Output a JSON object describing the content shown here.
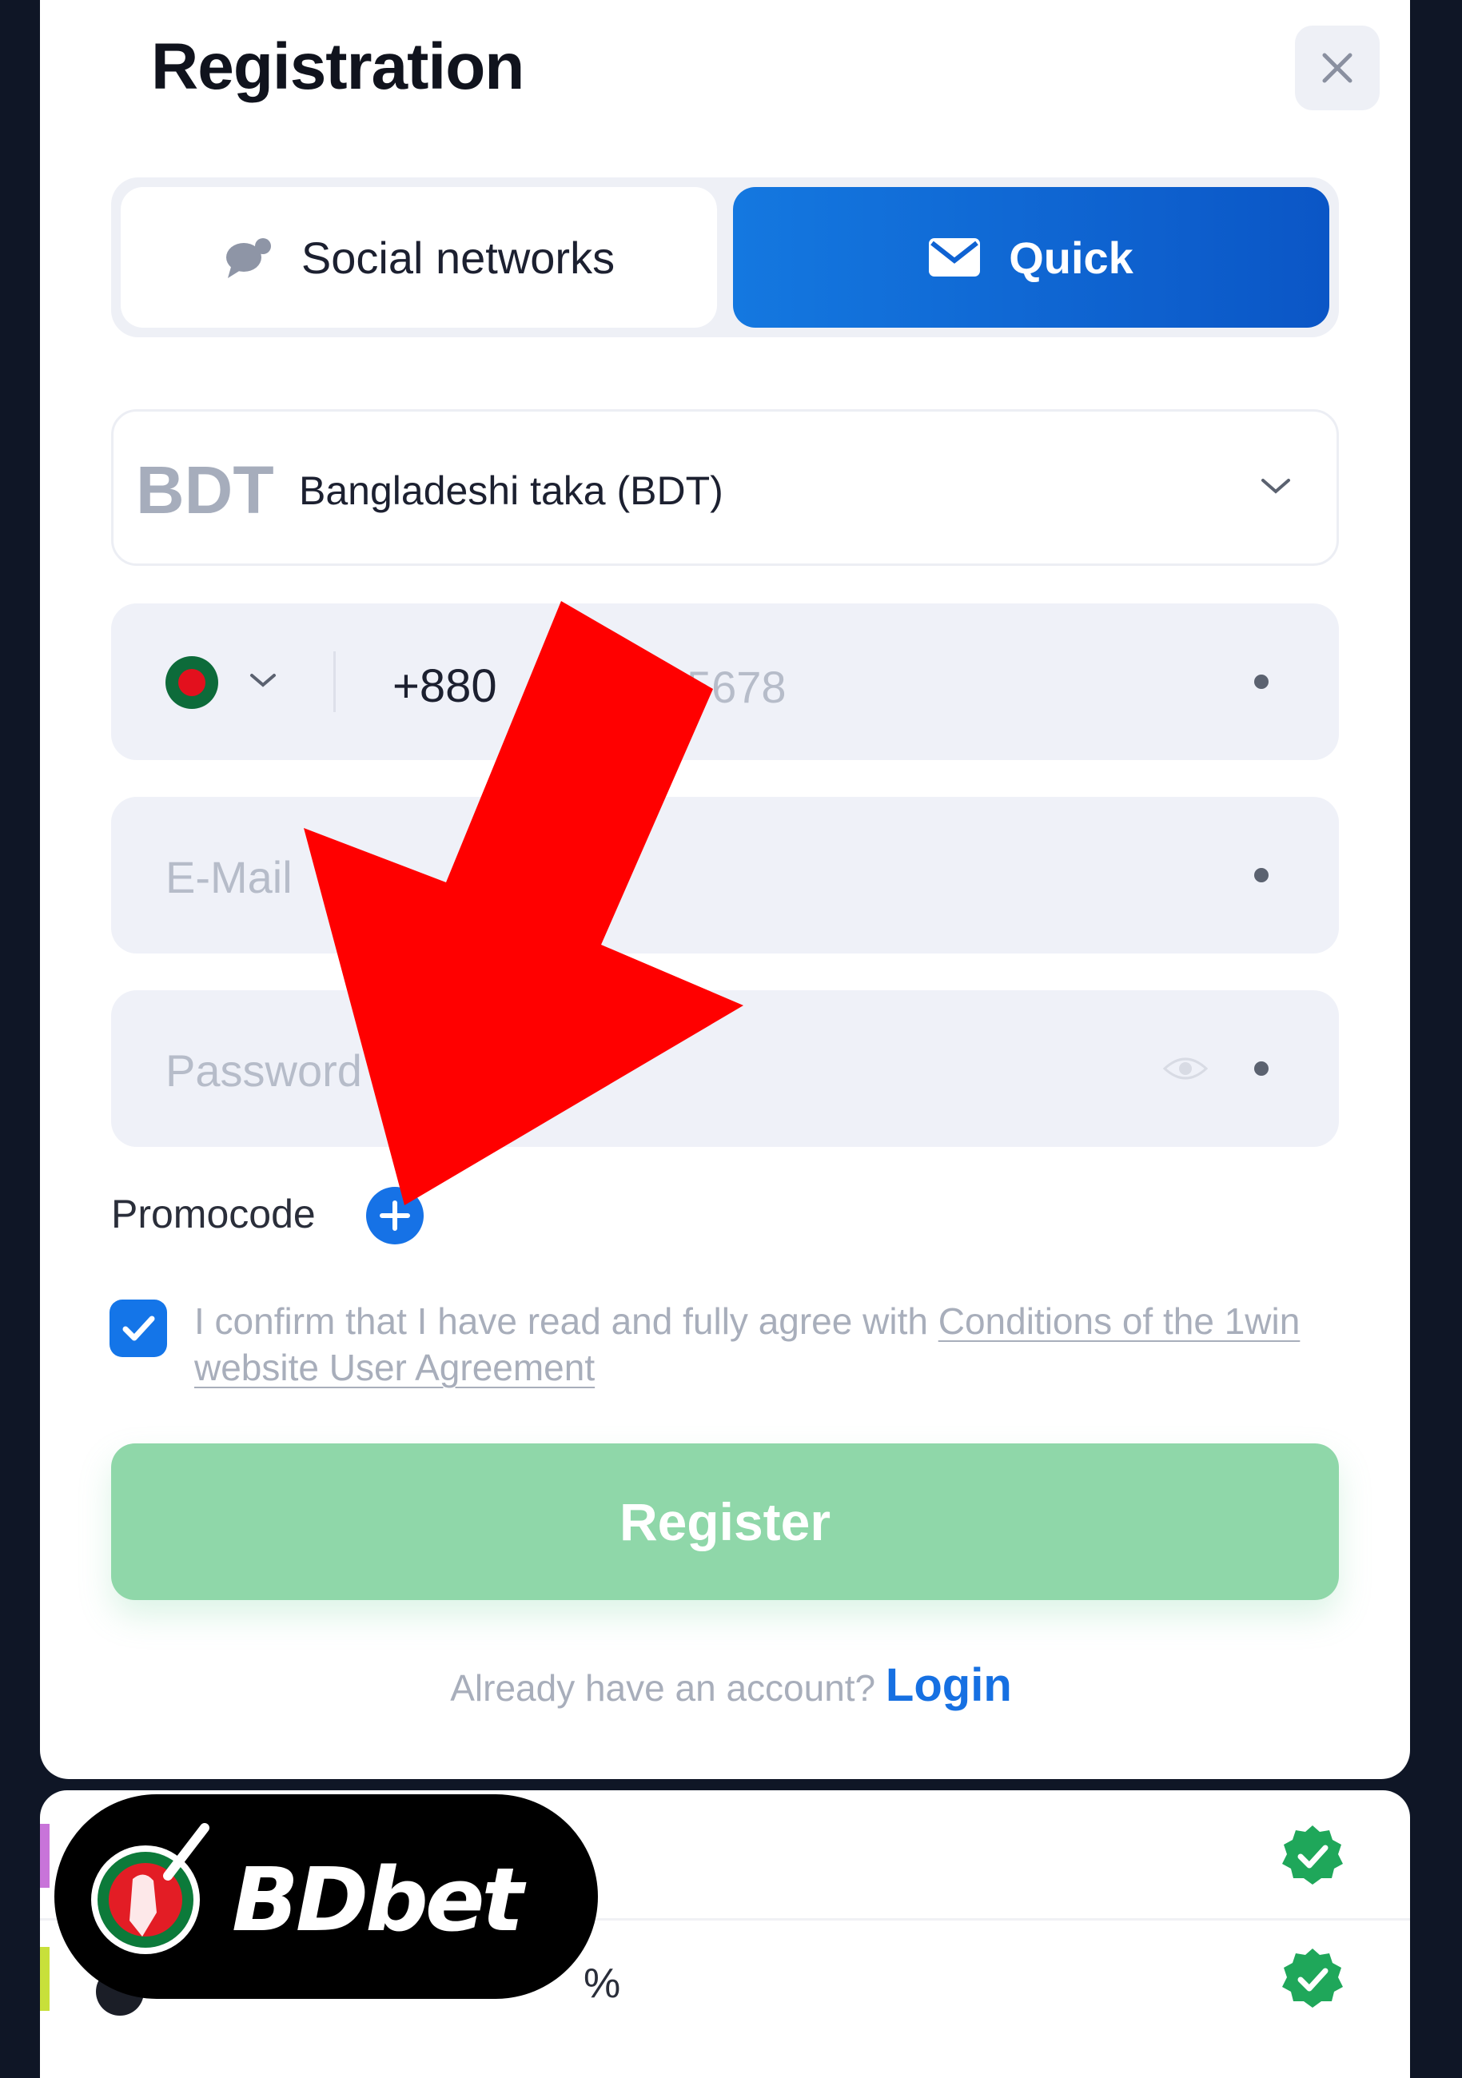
{
  "modal": {
    "title": "Registration",
    "close_icon": "close-icon"
  },
  "tabs": [
    {
      "label": "Social networks",
      "icon": "chat-bubbles-icon",
      "active": false
    },
    {
      "label": "Quick",
      "icon": "envelope-icon",
      "active": true
    }
  ],
  "currency": {
    "code": "BDT",
    "label": "Bangladeshi taka (BDT)"
  },
  "phone": {
    "country_icon": "bangladesh-flag-icon",
    "code": "+880",
    "placeholder_visible": "5678"
  },
  "email": {
    "placeholder": "E-Mail"
  },
  "password": {
    "placeholder": "Password"
  },
  "promocode": {
    "label": "Promocode"
  },
  "agreement": {
    "checked": true,
    "text": "I confirm that I have read and fully agree with ",
    "link": "Conditions of the 1win website User Agreement"
  },
  "register": {
    "label": "Register"
  },
  "login": {
    "prompt": "Already have an account?",
    "link": "Login"
  },
  "bottom_panel": {
    "row_text_fragment": "%"
  },
  "watermark": {
    "text": "BDbet"
  },
  "colors": {
    "accent_blue": "#1475e8",
    "register_green": "#8fd7a9",
    "arrow_red": "#ff0000",
    "badge_green": "#1fa75a"
  }
}
